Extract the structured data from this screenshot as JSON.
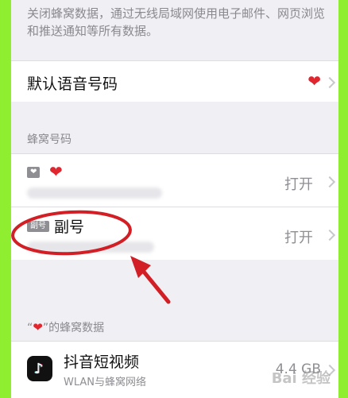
{
  "intro": {
    "text": "关闭蜂窝数据，通过无线局域网使用电子邮件、网页浏览和推送通知等所有数据。"
  },
  "default_voice": {
    "label": "默认语音号码",
    "value_icon": "heart-icon"
  },
  "cellular_numbers": {
    "header": "蜂窝号码",
    "lines": [
      {
        "badge": "heart-badge",
        "label_icon": "heart-icon",
        "status": "打开"
      },
      {
        "badge": "副号",
        "label": "副号",
        "status": "打开"
      }
    ]
  },
  "cellular_data_section": {
    "header_prefix": "“",
    "header_suffix": "”的蜂窝数据",
    "header_icon": "heart-icon"
  },
  "app": {
    "name": "抖音短视频",
    "subtitle": "WLAN与蜂窝网络",
    "size": "4.4 GB"
  },
  "watermark": "Bai 经验",
  "colors": {
    "background": "#90ee30",
    "heart": "#e0262f",
    "annotation": "#d21f26"
  }
}
